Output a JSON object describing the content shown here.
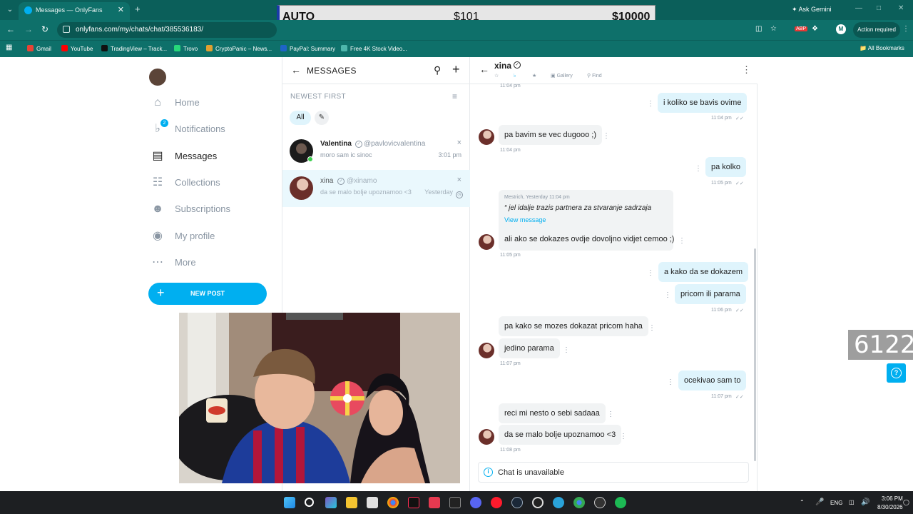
{
  "browser": {
    "tab_title": "Messages — OnlyFans",
    "url": "onlyfans.com/my/chats/chat/385536183/",
    "ask_gemini": "Ask Gemini",
    "action_required": "Action required",
    "bookmarks": [
      "Gmail",
      "YouTube",
      "TradingView – Track...",
      "Trovo",
      "CryptoPanic – News...",
      "PayPal: Summary",
      "Free 4K Stock Video..."
    ],
    "all_bookmarks": "All Bookmarks"
  },
  "overlay": {
    "mode": "AUTO",
    "amount1": "$101",
    "amount2": "$10000"
  },
  "sidebar": {
    "notification_badge": "2",
    "items": [
      {
        "label": "Home",
        "icon": "home-icon"
      },
      {
        "label": "Notifications",
        "icon": "bell-icon"
      },
      {
        "label": "Messages",
        "icon": "messages-icon"
      },
      {
        "label": "Collections",
        "icon": "collections-icon"
      },
      {
        "label": "Subscriptions",
        "icon": "subscriptions-icon"
      },
      {
        "label": "My profile",
        "icon": "profile-icon"
      },
      {
        "label": "More",
        "icon": "more-icon"
      }
    ],
    "new_post": "NEW POST"
  },
  "messages_list": {
    "title": "MESSAGES",
    "sort_label": "NEWEST FIRST",
    "filter_all": "All",
    "conversations": [
      {
        "name": "Valentina",
        "handle": "@pavlovicvalentina",
        "preview": "moro sam ic sinoc",
        "time": "3:01 pm"
      },
      {
        "name": "xina",
        "handle": "@xinamo",
        "preview": "da se malo bolje upoznamoo <3",
        "time": "Yesterday"
      }
    ]
  },
  "chat": {
    "name": "xina",
    "tools": {
      "gallery": "Gallery",
      "find": "Find"
    },
    "messages": [
      {
        "text": "",
        "time": "11:04 pm"
      },
      {
        "text": "i koliko se bavis ovime",
        "time": "11:04 pm"
      },
      {
        "text": "pa bavim se vec dugooo ;)",
        "time": "11:04 pm"
      },
      {
        "text": "pa kolko",
        "time": "11:05 pm"
      },
      {
        "quote_meta": "Mestrich, Yesterday 11:04 pm",
        "quote": "“ jel idalje trazis partnera za stvaranje sadrzaja",
        "view": "View message",
        "text": "ali ako se dokazes ovdje dovoljno vidjet cemoo ;)",
        "time": "11:05 pm"
      },
      {
        "text": "a kako da se dokazem"
      },
      {
        "text": "pricom ili parama",
        "time": "11:06 pm"
      },
      {
        "text": "pa kako se mozes dokazat pricom haha"
      },
      {
        "text": "jedino parama",
        "time": "11:07 pm"
      },
      {
        "text": "ocekivao sam to",
        "time": "11:07 pm"
      },
      {
        "text": "reci mi nesto o sebi sadaaa"
      },
      {
        "text": "da se malo bolje upoznamoo <3",
        "time": "11:08 pm"
      }
    ],
    "unavailable": "Chat is unavailable"
  },
  "stream_counter": "6122",
  "taskbar": {
    "lang": "ENG",
    "time": "3:06 PM",
    "date": "8/30/2026"
  }
}
